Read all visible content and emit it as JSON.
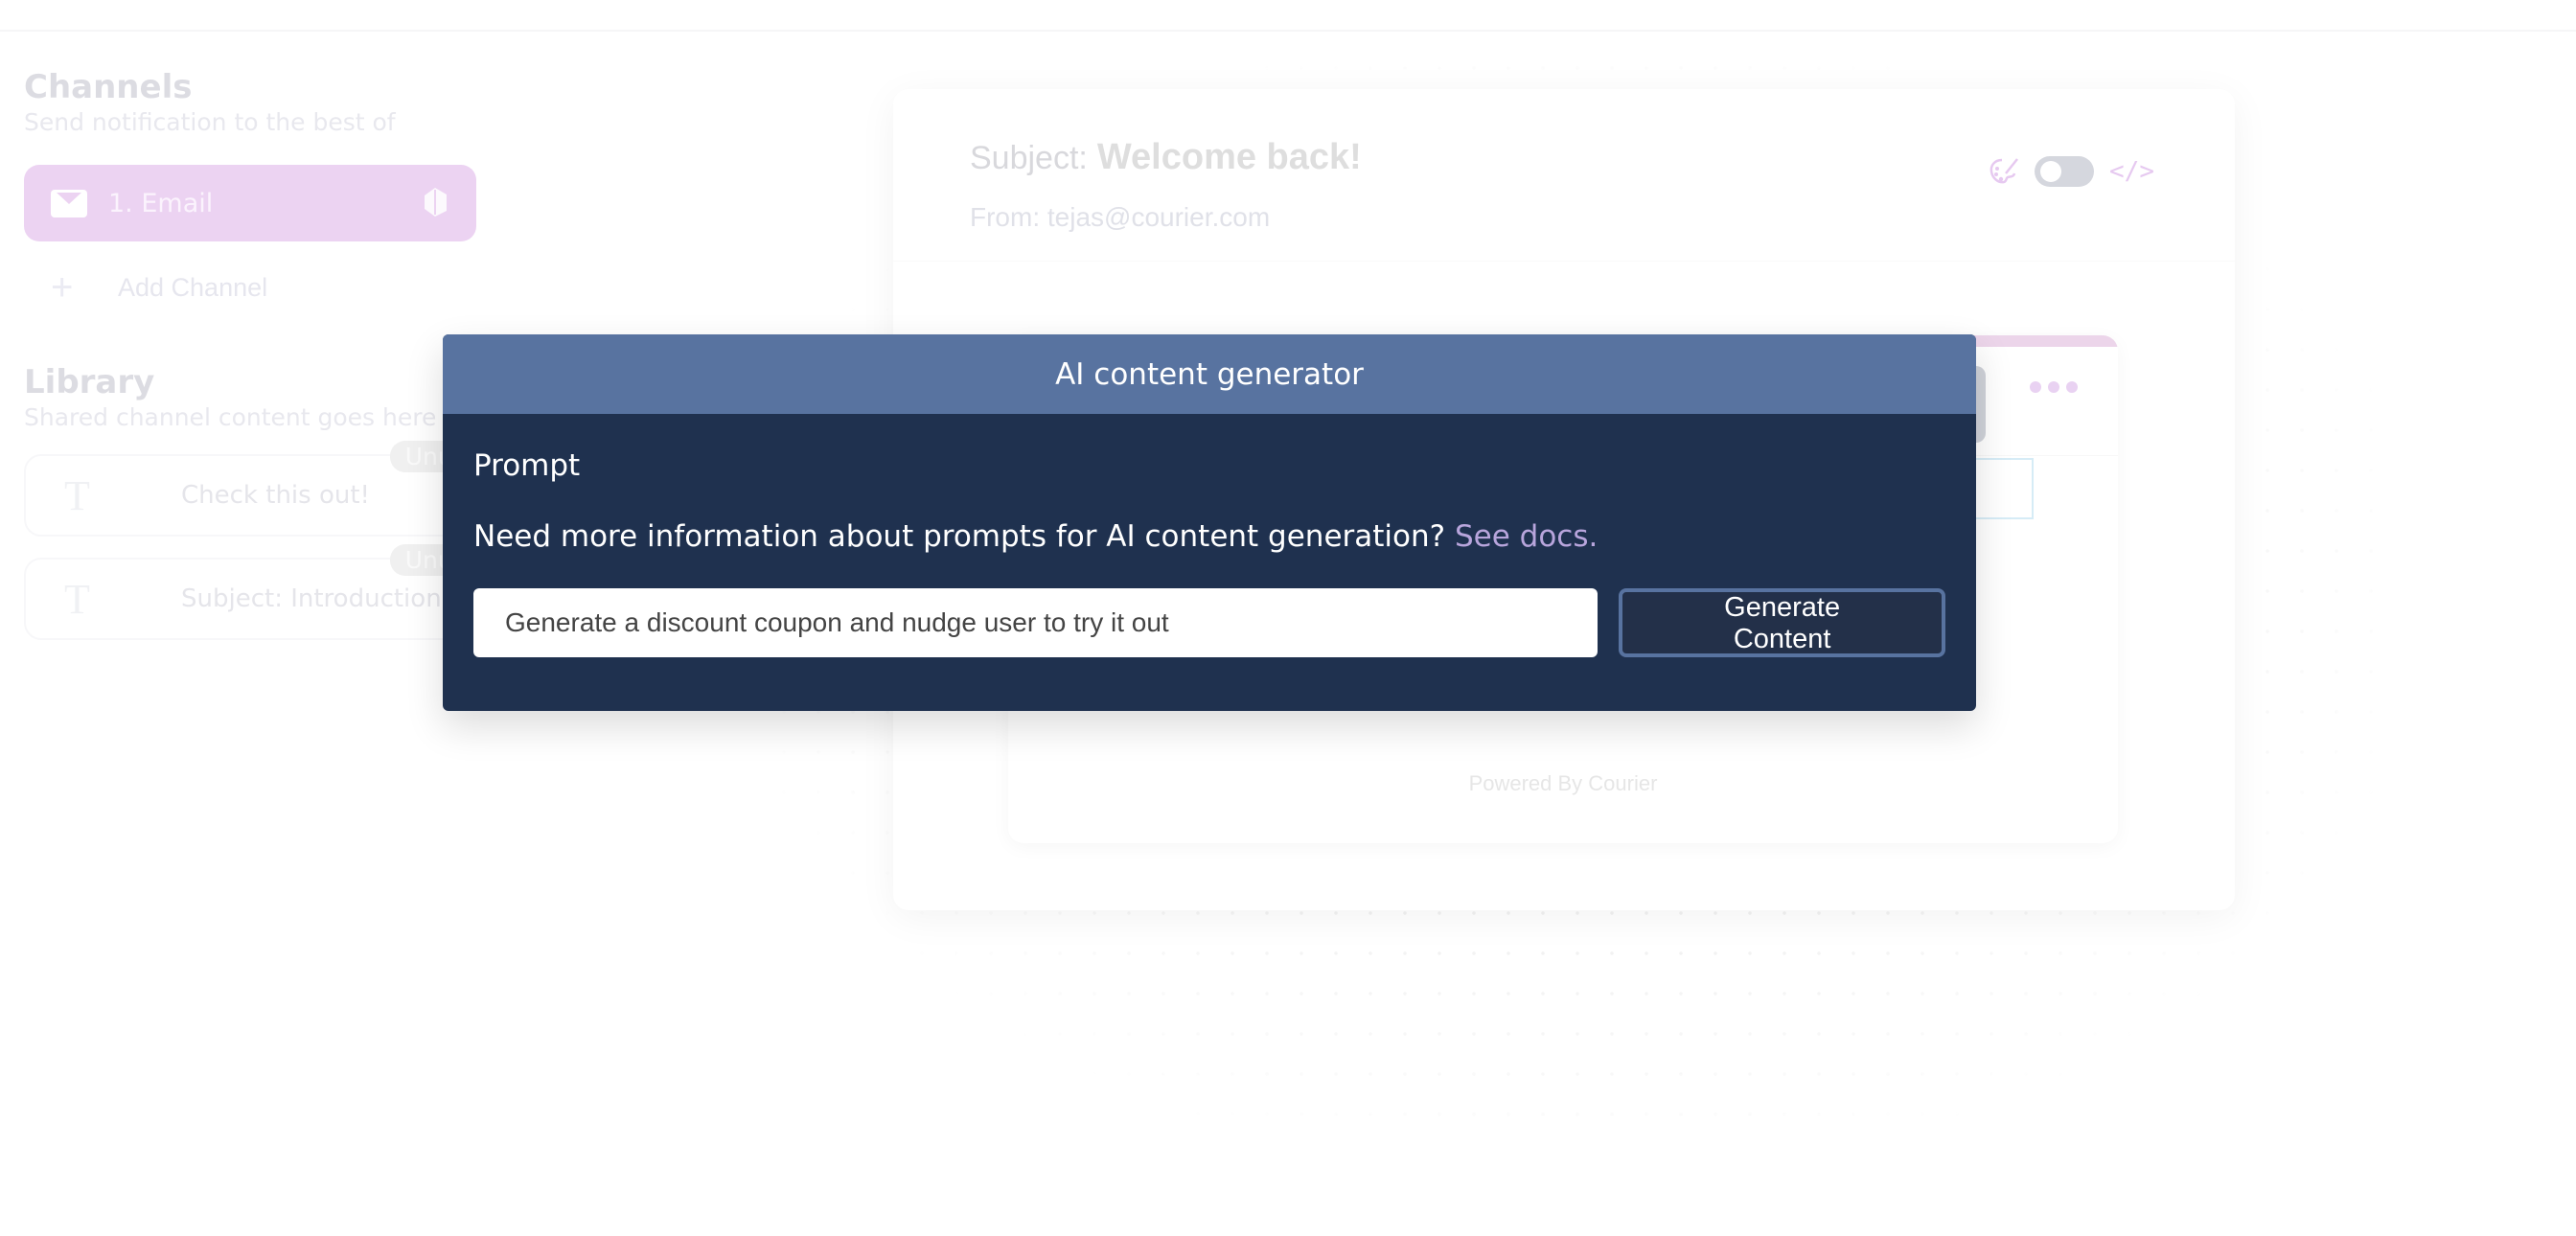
{
  "sidebar": {
    "channels": {
      "title": "Channels",
      "subtitle": "Send notification to the best of",
      "items": [
        {
          "icon": "mail-icon",
          "label": "1.  Email",
          "provider_icon": "provider-logo-icon",
          "color": "#ecd3f2"
        }
      ],
      "add_label": "Add Channel"
    },
    "library": {
      "title": "Library",
      "subtitle": "Shared channel content goes here",
      "items": [
        {
          "icon": "text-icon",
          "label": "Check this out!",
          "badge": "Unused"
        },
        {
          "icon": "text-icon",
          "label": "Subject: Introduction...",
          "badge": "Unused"
        }
      ]
    }
  },
  "editor": {
    "subject_label": "Subject:",
    "subject_value": "Welcome back!",
    "from": "From: tejas@courier.com",
    "tools": {
      "palette_icon": "palette-icon",
      "toggle_state": "off",
      "code_icon": "</>"
    },
    "template": {
      "more_icon": "more-dots-icon",
      "footer": "Powered By Courier"
    }
  },
  "modal": {
    "title": "AI content generator",
    "prompt_label": "Prompt",
    "info_text": "Need more information about prompts for AI content generation?",
    "docs_link": "See docs.",
    "prompt_value": "Generate a discount coupon and nudge user to try it out",
    "generate_button": "Generate Content",
    "colors": {
      "header": "#5873a0",
      "body": "#1f314f",
      "link": "#b8a5dc"
    }
  }
}
